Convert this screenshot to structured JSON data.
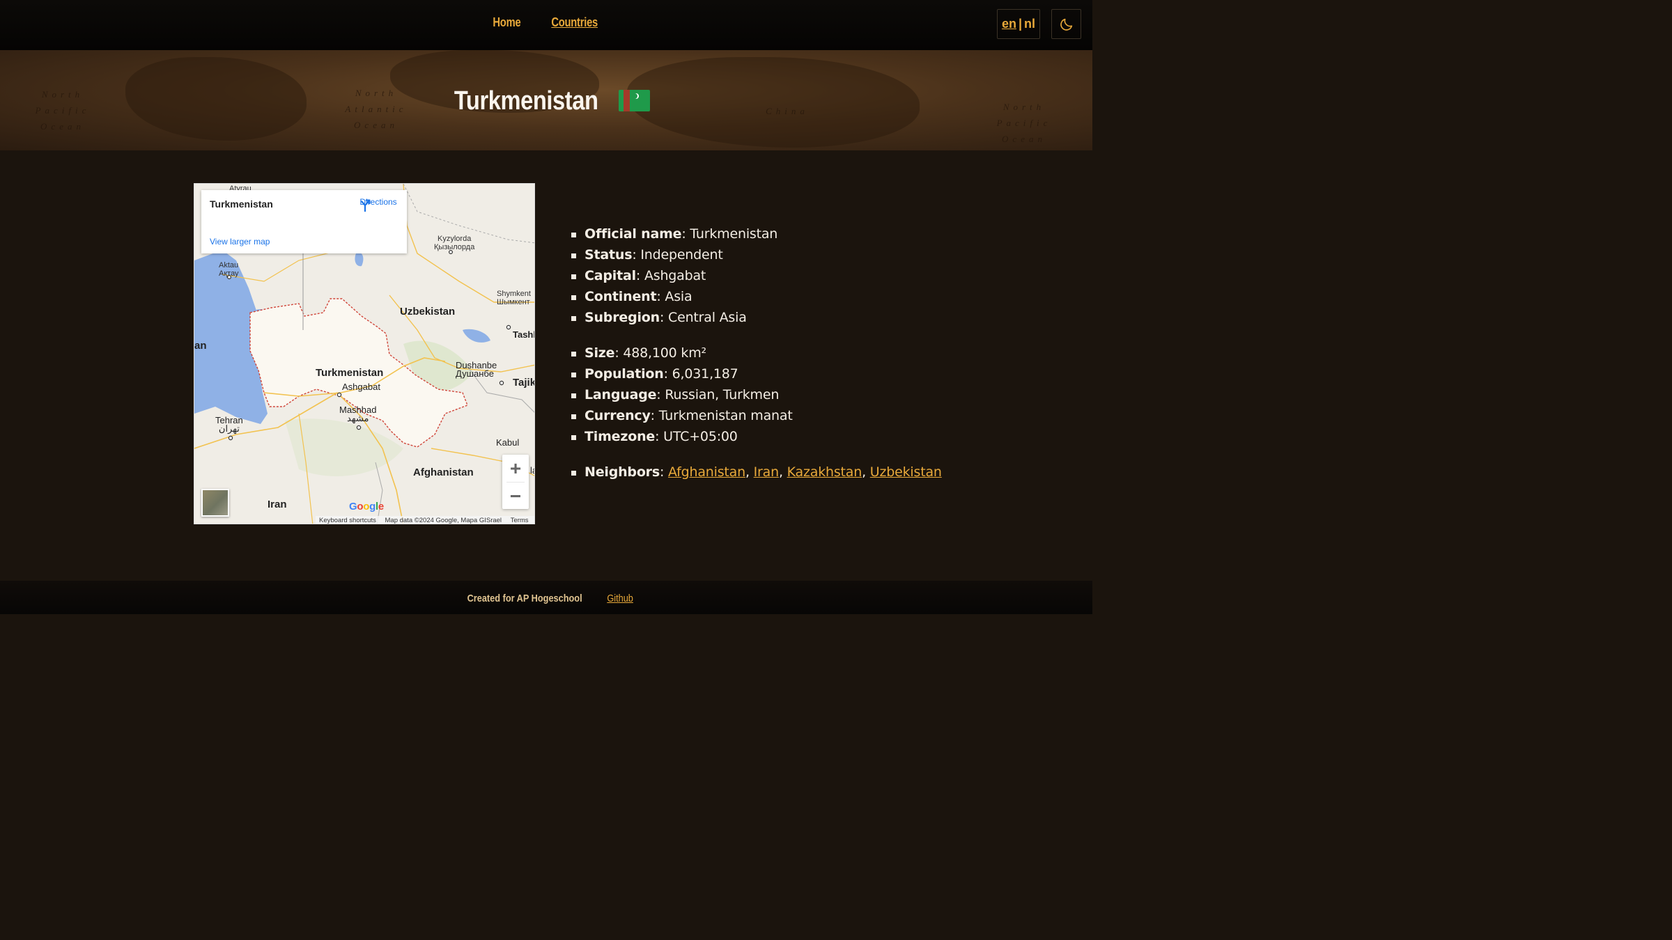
{
  "nav": {
    "home": "Home",
    "countries": "Countries",
    "lang_en": "en",
    "lang_sep": "|",
    "lang_nl": "nl",
    "theme_icon": "moon-icon"
  },
  "hero": {
    "title": "Turkmenistan",
    "flag_icon": "turkmenistan-flag-icon",
    "oceans": [
      "North Pacific Ocean",
      "North Atlantic Ocean",
      "China",
      "North Pacific Ocean"
    ]
  },
  "map": {
    "infobox": {
      "title": "Turkmenistan",
      "directions": "Directions",
      "view_larger": "View larger map"
    },
    "labels": {
      "atyrau": "Atyrau",
      "kyzylorda": "Kyzylorda",
      "kyzylorda_cyr": "Қызылорда",
      "aktau": "Aktau",
      "aktau_cyr": "Ақтау",
      "shymkent": "Shymkent",
      "shymkent_cyr": "Шымкент",
      "uzbekistan": "Uzbekistan",
      "tashkent": "Tashk",
      "turkmenistan": "Turkmenistan",
      "ashgabat": "Ashgabat",
      "dushanbe": "Dushanbe",
      "dushanbe_cyr": "Душанбе",
      "tajik": "Tajik",
      "mashhad": "Mashhad",
      "mashhad_fa": "مشهد",
      "tehran": "Tehran",
      "tehran_fa": "تهران",
      "kabul": "Kabul",
      "afghanistan": "Afghanistan",
      "iran": "Iran",
      "an": "an",
      "la": "la"
    },
    "zoom_in": "+",
    "zoom_out": "−",
    "google": "Google",
    "attribution": {
      "shortcuts": "Keyboard shortcuts",
      "data": "Map data ©2024 Google, Mapa GISrael",
      "terms": "Terms"
    }
  },
  "facts": {
    "official_name": {
      "label": "Official name",
      "value": "Turkmenistan"
    },
    "status": {
      "label": "Status",
      "value": "Independent"
    },
    "capital": {
      "label": "Capital",
      "value": "Ashgabat"
    },
    "continent": {
      "label": "Continent",
      "value": "Asia"
    },
    "subregion": {
      "label": "Subregion",
      "value": "Central Asia"
    },
    "size": {
      "label": "Size",
      "value": "488,100 km²"
    },
    "population": {
      "label": "Population",
      "value": "6,031,187"
    },
    "language": {
      "label": "Language",
      "value": "Russian, Turkmen"
    },
    "currency": {
      "label": "Currency",
      "value": "Turkmenistan manat"
    },
    "timezone": {
      "label": "Timezone",
      "value": "UTC+05:00"
    },
    "neighbors": {
      "label": "Neighbors",
      "items": [
        "Afghanistan",
        "Iran",
        "Kazakhstan",
        "Uzbekistan"
      ]
    }
  },
  "footer": {
    "credit": "Created for AP Hogeschool",
    "github": "Github"
  },
  "colors": {
    "accent": "#e8a93a",
    "background": "#1b140d",
    "text": "#f3ede4"
  }
}
